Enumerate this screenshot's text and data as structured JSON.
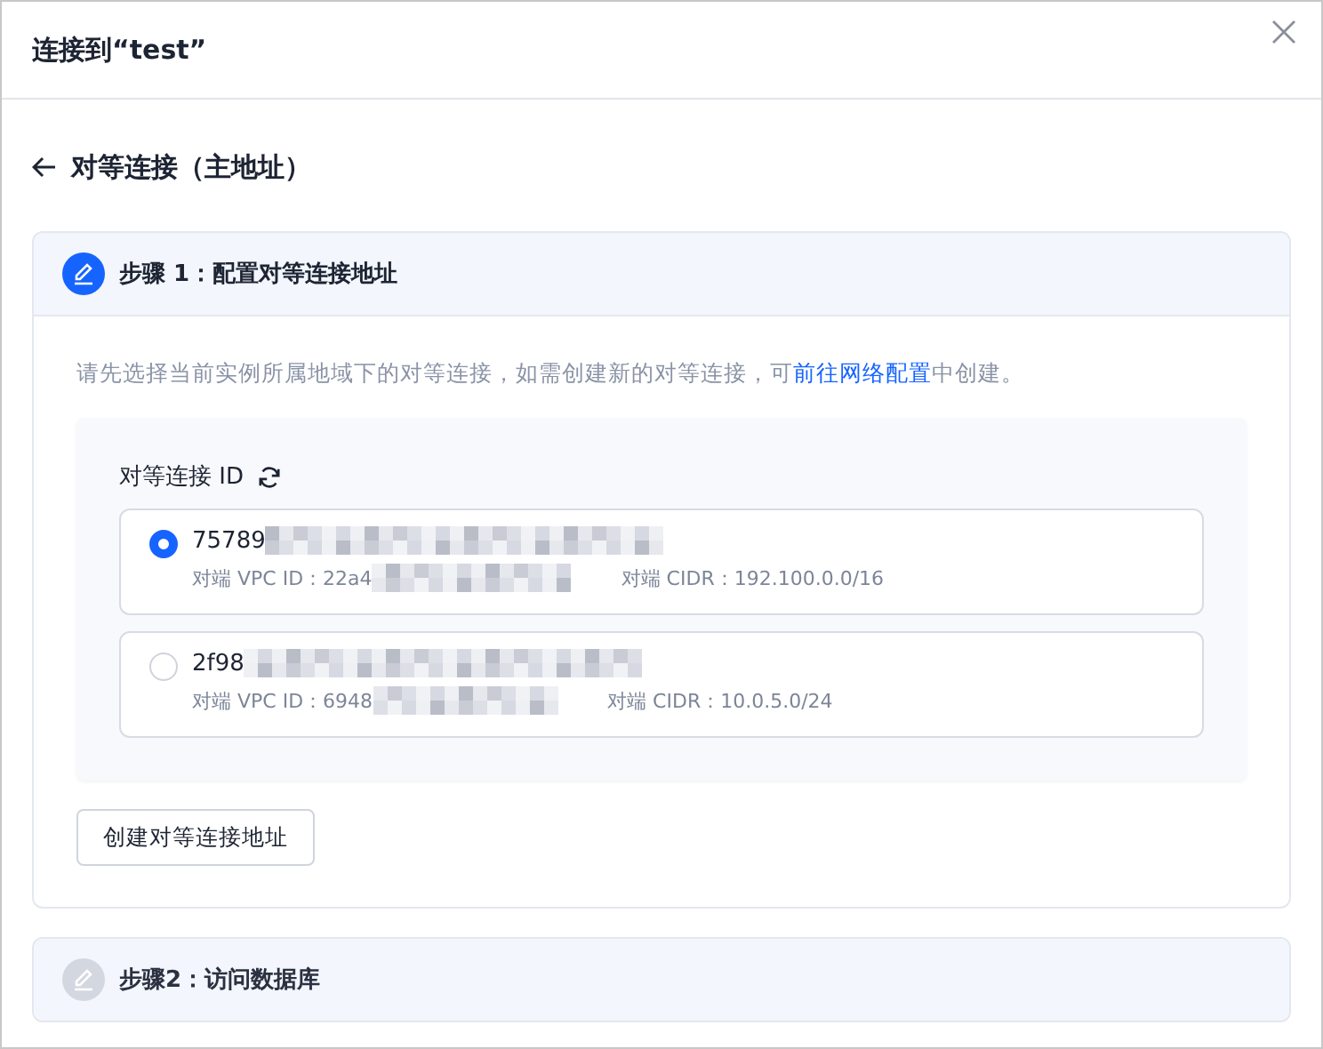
{
  "window": {
    "title": "连接到“test”"
  },
  "page": {
    "title": "对等连接（主地址）"
  },
  "steps": [
    {
      "title": "步骤 1：配置对等连接地址",
      "active": true,
      "description": {
        "before": "请先选择当前实例所属地域下的对等连接，如需创建新的对等连接，可",
        "link": "前往网络配置",
        "after": "中创建。"
      },
      "field_label": "对等连接 ID",
      "options": [
        {
          "id": "75789",
          "selected": true,
          "vpc_label": "对端 VPC ID：",
          "vpc_id": "22a4",
          "cidr_label": "对端 CIDR：",
          "cidr": "192.100.0.0/16"
        },
        {
          "id": "2f98",
          "selected": false,
          "vpc_label": "对端 VPC ID：",
          "vpc_id": "6948",
          "cidr_label": "对端 CIDR：",
          "cidr": "10.0.5.0/24"
        }
      ],
      "button": "创建对等连接地址"
    },
    {
      "title": "步骤2：访问数据库",
      "active": false
    }
  ]
}
